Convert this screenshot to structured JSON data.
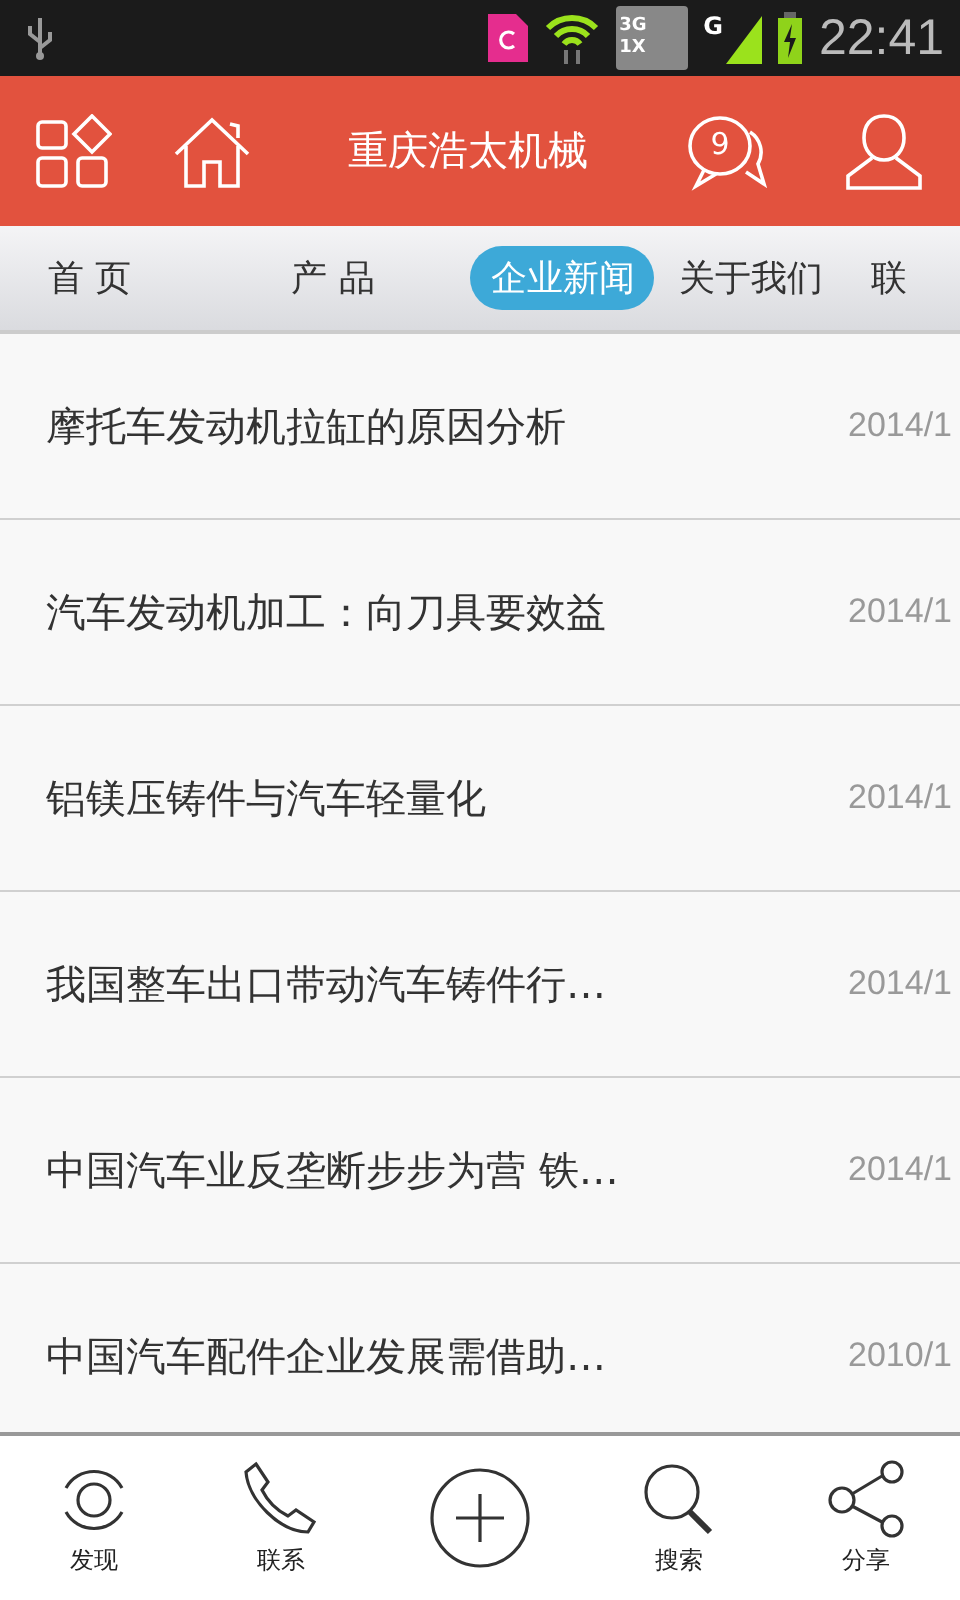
{
  "status_bar": {
    "network_labels": [
      "3G",
      "1X",
      "G"
    ],
    "time": "22:41"
  },
  "header": {
    "title": "重庆浩太机械",
    "message_count": "9"
  },
  "tabs": [
    {
      "label": "首 页",
      "selected": false
    },
    {
      "label": "产 品",
      "selected": false
    },
    {
      "label": "企业新闻",
      "selected": true
    },
    {
      "label": "关于我们",
      "selected": false
    },
    {
      "label": "联",
      "selected": false
    }
  ],
  "news": [
    {
      "title": "摩托车发动机拉缸的原因分析",
      "date": "2014/1"
    },
    {
      "title": "汽车发动机加工：向刀具要效益",
      "date": "2014/1"
    },
    {
      "title": "铝镁压铸件与汽车轻量化",
      "date": "2014/1"
    },
    {
      "title": "我国整车出口带动汽车铸件行…",
      "date": "2014/1"
    },
    {
      "title": "中国汽车业反垄断步步为营 铁…",
      "date": "2014/1"
    },
    {
      "title": "中国汽车配件企业发展需借助…",
      "date": "2010/1"
    }
  ],
  "bottom_nav": [
    {
      "kind": "discover",
      "label": "发现"
    },
    {
      "kind": "phone",
      "label": "联系"
    },
    {
      "kind": "add"
    },
    {
      "kind": "search",
      "label": "搜索"
    },
    {
      "kind": "share",
      "label": "分享"
    }
  ]
}
